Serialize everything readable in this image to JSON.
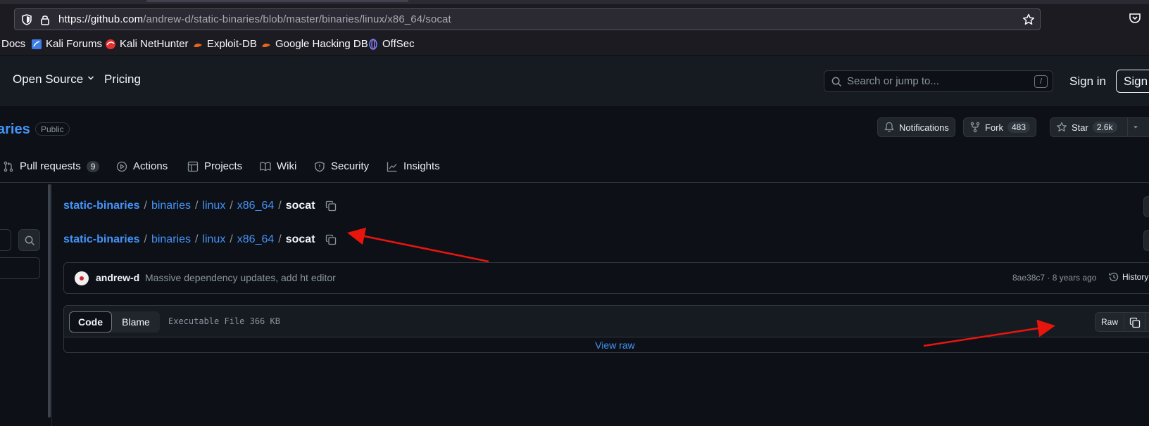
{
  "browser": {
    "url_host": "https://github.com",
    "url_path": "/andrew-d/static-binaries/blob/master/binaries/linux/x86_64/socat"
  },
  "bookmarks": [
    {
      "label": "Docs",
      "icon": "kali-docs-icon"
    },
    {
      "label": "Kali Forums",
      "icon": "kali-forums-icon"
    },
    {
      "label": "Kali NetHunter",
      "icon": "kali-nethunter-icon"
    },
    {
      "label": "Exploit-DB",
      "icon": "exploit-db-icon"
    },
    {
      "label": "Google Hacking DB",
      "icon": "ghdb-icon"
    },
    {
      "label": "OffSec",
      "icon": "offsec-icon"
    }
  ],
  "header": {
    "open_source": "Open Source",
    "pricing": "Pricing",
    "search_placeholder": "Search or jump to...",
    "search_shortcut": "/",
    "sign_in": "Sign in",
    "sign_up": "Sign up"
  },
  "repo": {
    "name_fragment": "aries",
    "visibility": "Public",
    "notifications": "Notifications",
    "fork_label": "Fork",
    "fork_count": "483",
    "star_label": "Star",
    "star_count": "2.6k"
  },
  "tabs": [
    {
      "label": "Pull requests",
      "count": "9"
    },
    {
      "label": "Actions"
    },
    {
      "label": "Projects"
    },
    {
      "label": "Wiki"
    },
    {
      "label": "Security"
    },
    {
      "label": "Insights"
    }
  ],
  "breadcrumb": {
    "repo": "static-binaries",
    "path": [
      "binaries",
      "linux",
      "x86_64"
    ],
    "separator": "/",
    "file": "socat"
  },
  "commit": {
    "author": "andrew-d",
    "message": "Massive dependency updates, add ht editor",
    "meta": "8ae38c7 · 8 years ago",
    "history": "History"
  },
  "file": {
    "tab_code": "Code",
    "tab_blame": "Blame",
    "info": "Executable File  366 KB",
    "raw": "Raw",
    "view_raw": "View raw"
  },
  "annotations": {
    "arrow_color": "#e8150d"
  }
}
